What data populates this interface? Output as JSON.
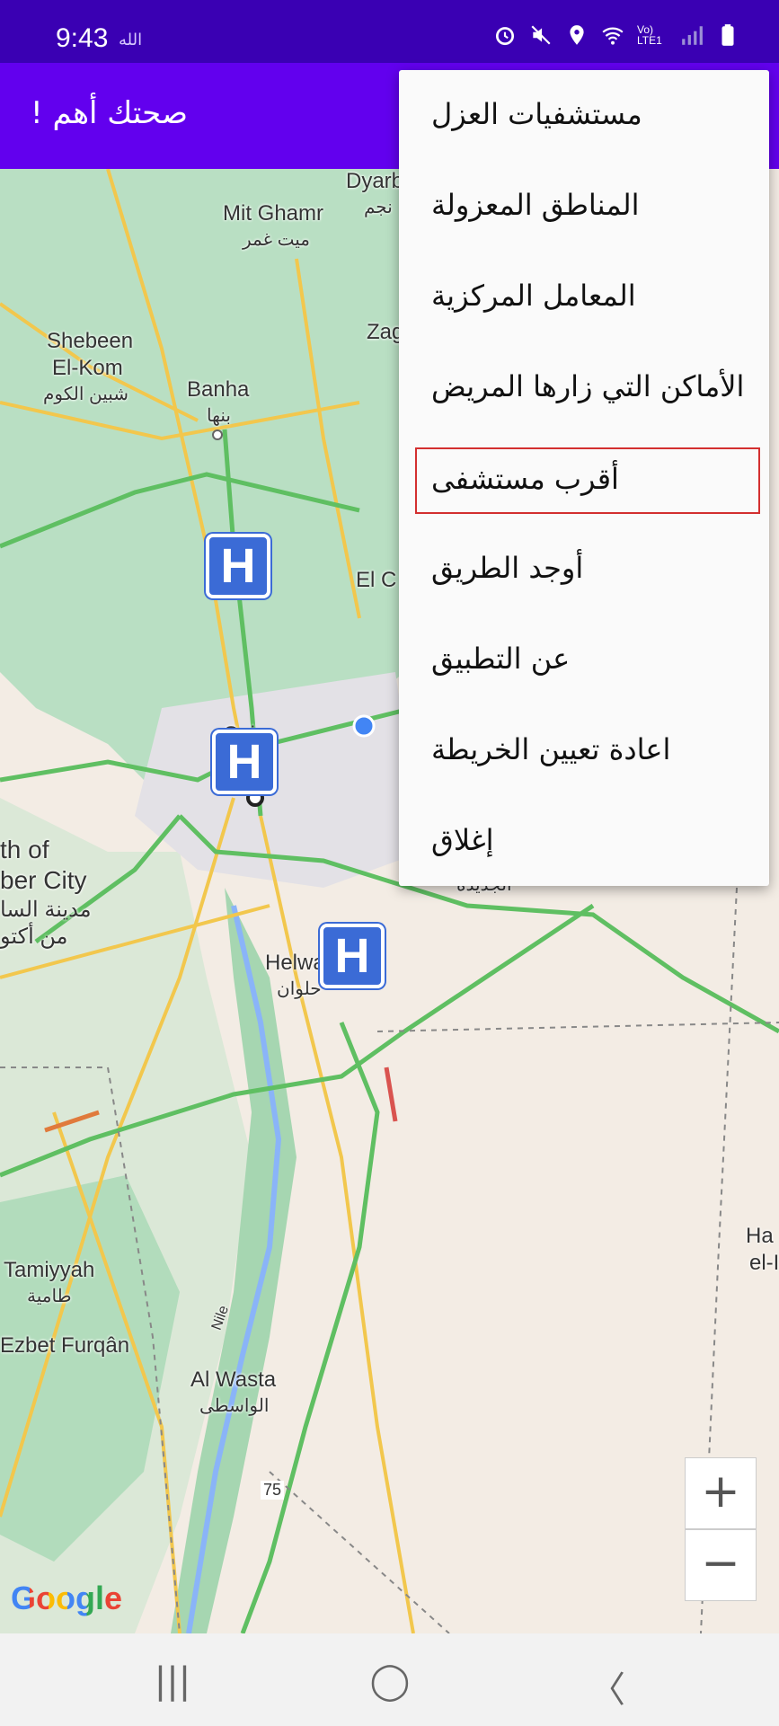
{
  "status_bar": {
    "time": "9:43",
    "indicator": "الله",
    "icons": [
      "alarm-icon",
      "mute-icon",
      "location-icon",
      "wifi-icon",
      "lte-signal-icon",
      "battery-icon"
    ],
    "network": "Vo) LTE1"
  },
  "app_bar": {
    "title": "صحتك أهم !"
  },
  "menu": {
    "items": [
      {
        "label": "مستشفيات العزل"
      },
      {
        "label": "المناطق المعزولة"
      },
      {
        "label": "المعامل المركزية"
      },
      {
        "label": "الأماكن التي زارها المريض"
      },
      {
        "label": "أقرب مستشفى"
      },
      {
        "label": "أوجد الطريق"
      },
      {
        "label": "عن التطبيق"
      },
      {
        "label": "اعادة تعيين الخريطة"
      },
      {
        "label": "إغلاق"
      }
    ]
  },
  "map": {
    "labels": {
      "mit_ghamr": "Mit Ghamr",
      "mit_ghamr_ar": "ميت غمر",
      "dyarb": "Dyarb",
      "dyarb_ar": "نجم",
      "shebeen": "Shebeen",
      "el_kom": "El-Kom",
      "shebeen_ar": "شبين الكوم",
      "banha": "Banha",
      "banha_ar": "بنها",
      "zag": "Zag",
      "el_c": "El C",
      "cairo": "Cairo",
      "sixth_1": "th of",
      "sixth_2": "ber City",
      "sixth_ar1": "مدينة السا",
      "sixth_ar2": "من أكتو",
      "helwan": "Helwa",
      "helwan_ar": "حلوان",
      "new_cairo_ar": "الجديدة",
      "tamiyyah": "Tamiyyah",
      "tamiyyah_ar": "طامية",
      "ezbet": "Ezbet Furqân",
      "al_wasta": "Al Wasta",
      "al_wasta_ar": "الواسطى",
      "nile": "Nile",
      "road_75": "75",
      "ha": "Ha",
      "el_i": "el-I"
    },
    "zoom_in": "+",
    "zoom_out": "−",
    "attribution": "Google"
  },
  "nav_bar": {
    "recent": "|||",
    "home": "◯",
    "back": "〈"
  },
  "colors": {
    "status_bar": "#3a00b3",
    "app_bar": "#6200ee",
    "hospital_marker": "#3b6bd6",
    "highlight": "#d32f2f"
  }
}
